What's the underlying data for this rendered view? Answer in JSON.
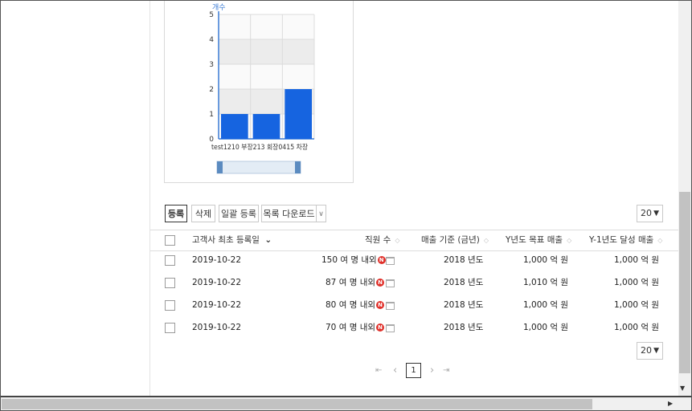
{
  "chart_data": {
    "type": "bar",
    "ylabel": "개수",
    "ylim": [
      0,
      5
    ],
    "yticks": [
      "0",
      "1",
      "2",
      "3",
      "4",
      "5"
    ],
    "categories": [
      "test1210",
      "부장213",
      "회장0415",
      "차장"
    ],
    "values": [
      1,
      1,
      2
    ],
    "x_tick_text": "test1210 부장213 회장0415 차장",
    "color": "#1664e0",
    "grid": true
  },
  "toolbar": {
    "register": "등록",
    "delete": "삭제",
    "bulk_register": "일괄 등록",
    "download": "목록 다운로드",
    "download_arrow": "∨",
    "page_size": "20",
    "page_size_arrow": "▼"
  },
  "table": {
    "headers": {
      "date": "고객사 최초 등록일",
      "date_sort": "⌄",
      "employees": "직원 수",
      "basis": "매출 기준 (금년)",
      "target": "Y년도 목표 매출",
      "achieved": "Y-1년도 달성 매출",
      "sort_icon": "◇"
    },
    "badge": "N",
    "rows": [
      {
        "date": "2019-10-22",
        "employees": "150 여 명 내외",
        "basis": "2018 년도",
        "target": "1,000 억 원",
        "achieved": "1,000 억 원"
      },
      {
        "date": "2019-10-22",
        "employees": "87 여 명 내외",
        "basis": "2018 년도",
        "target": "1,010 억 원",
        "achieved": "1,000 억 원"
      },
      {
        "date": "2019-10-22",
        "employees": "80 여 명 내외",
        "basis": "2018 년도",
        "target": "1,000 억 원",
        "achieved": "1,000 억 원"
      },
      {
        "date": "2019-10-22",
        "employees": "70 여 명 내외",
        "basis": "2018 년도",
        "target": "1,000 억 원",
        "achieved": "1,000 억 원"
      }
    ]
  },
  "pager": {
    "first": "⇤",
    "prev": "‹",
    "current": "1",
    "next": "›",
    "last": "⇥",
    "page_size": "20",
    "page_size_arrow": "▼"
  },
  "scroll": {
    "down_arrow": "▼",
    "right_arrow": "▶"
  }
}
